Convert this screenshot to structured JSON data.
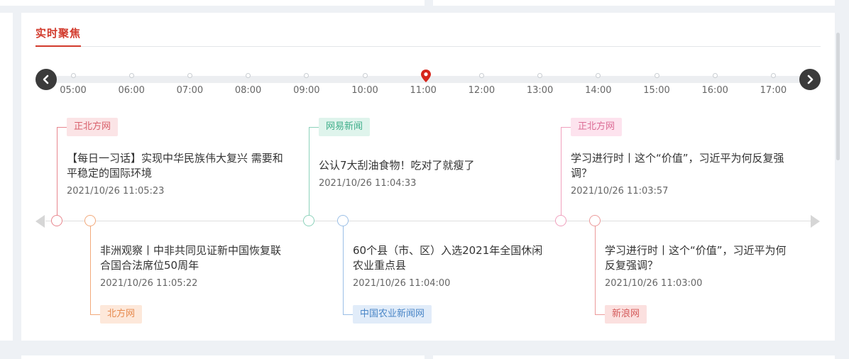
{
  "section": {
    "title": "实时聚焦"
  },
  "timeline": {
    "prev_icon": "chevron-left-icon",
    "next_icon": "chevron-right-icon",
    "marker_icon": "map-pin-icon",
    "active_time": "11:00",
    "hours": [
      "05:00",
      "06:00",
      "07:00",
      "08:00",
      "09:00",
      "10:00",
      "11:00",
      "12:00",
      "13:00",
      "14:00",
      "15:00",
      "16:00",
      "17:00"
    ]
  },
  "news": [
    {
      "position": "top",
      "source": "正北方网",
      "title_lines": [
        "【每日一习话】实现中华民族伟大复兴 需要和",
        "平稳定的国际环境"
      ],
      "time": "2021/10/26 11:05:23",
      "color": "#e8868e",
      "tag_bg": "#fbe4e6",
      "tag_color": "#d9606b"
    },
    {
      "position": "bottom",
      "source": "北方网",
      "title_lines": [
        "非洲观察丨中非共同见证新中国恢复联",
        "合国合法席位50周年"
      ],
      "time": "2021/10/26 11:05:22",
      "color": "#f2a97b",
      "tag_bg": "#fde8da",
      "tag_color": "#e78a4e"
    },
    {
      "position": "top",
      "source": "网易新闻",
      "title_lines": [
        "公认7大刮油食物！吃对了就瘦了"
      ],
      "time": "2021/10/26 11:04:33",
      "color": "#8cd2bb",
      "tag_bg": "#dff4ec",
      "tag_color": "#3fae8a"
    },
    {
      "position": "bottom",
      "source": "中国农业新闻网",
      "title_lines": [
        "60个县（市、区）入选2021年全国休闲",
        "农业重点县"
      ],
      "time": "2021/10/26 11:04:00",
      "color": "#9bbfe6",
      "tag_bg": "#e1ecf9",
      "tag_color": "#4a86c7"
    },
    {
      "position": "top",
      "source": "正北方网",
      "title_lines": [
        "学习进行时丨这个“价值”，习近平为何反复强",
        "调？"
      ],
      "time": "2021/10/26 11:03:57",
      "color": "#f0a0bd",
      "tag_bg": "#fde3ee",
      "tag_color": "#dc6c95"
    },
    {
      "position": "bottom",
      "source": "新浪网",
      "title_lines": [
        "学习进行时丨这个“价值”，习近平为何",
        "反复强调？"
      ],
      "time": "2021/10/26 11:03:00",
      "color": "#ec9a9a",
      "tag_bg": "#fbe0df",
      "tag_color": "#d45a5a"
    }
  ]
}
